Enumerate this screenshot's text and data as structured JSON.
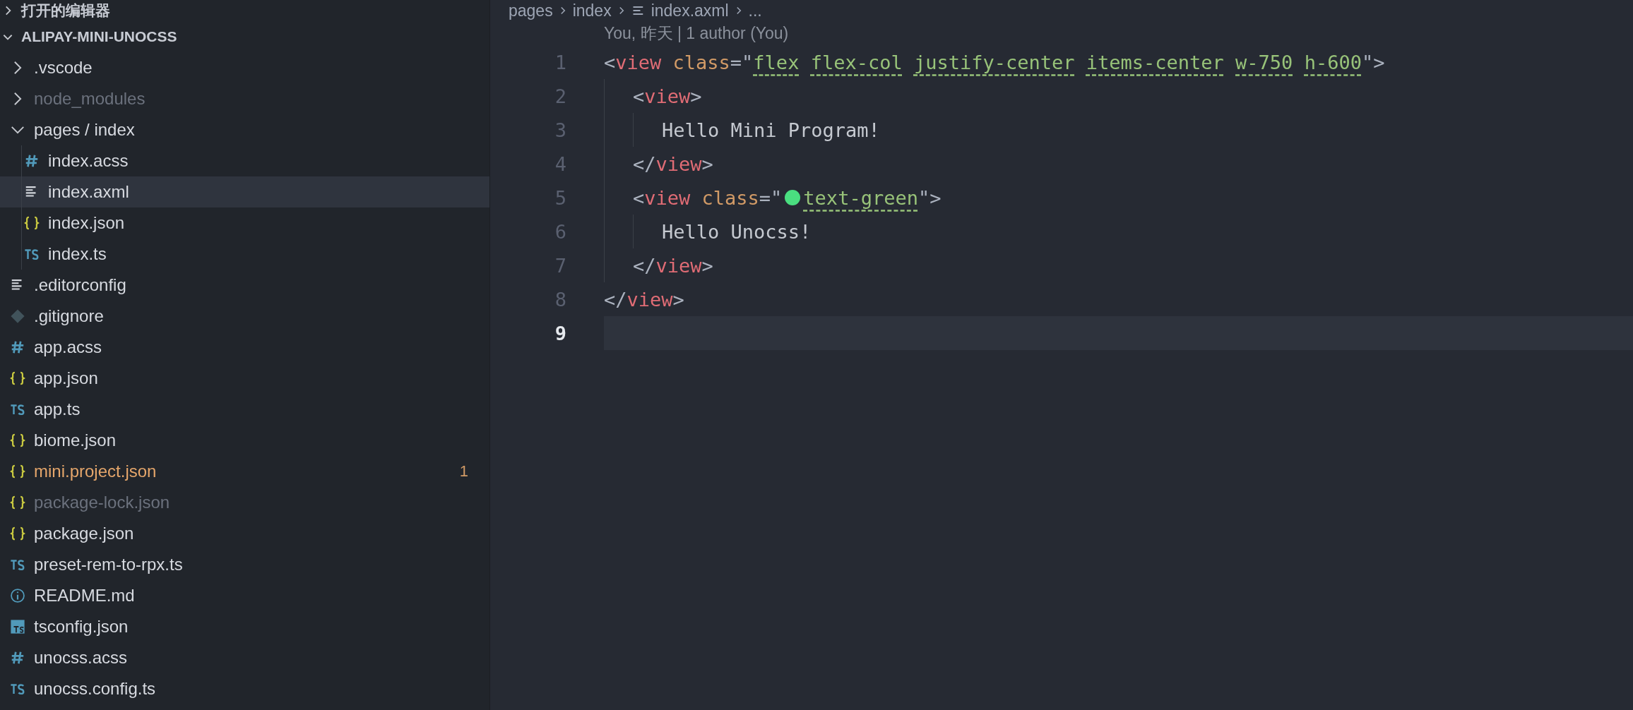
{
  "sidebar": {
    "sections": [
      {
        "label": "打开的编辑器",
        "expanded": false
      },
      {
        "label": "ALIPAY-MINI-UNOCSS",
        "expanded": true
      }
    ],
    "tree": [
      {
        "name": ".vscode",
        "kind": "folder",
        "expanded": false,
        "ignored": false,
        "selected": false
      },
      {
        "name": "node_modules",
        "kind": "folder",
        "expanded": false,
        "ignored": true,
        "selected": false
      },
      {
        "name": "pages / index",
        "kind": "folder",
        "expanded": true,
        "ignored": false,
        "selected": false,
        "children": [
          {
            "name": "index.acss",
            "kind": "css",
            "ignored": false,
            "selected": false
          },
          {
            "name": "index.axml",
            "kind": "lines",
            "ignored": false,
            "selected": true
          },
          {
            "name": "index.json",
            "kind": "json",
            "ignored": false,
            "selected": false
          },
          {
            "name": "index.ts",
            "kind": "ts",
            "ignored": false,
            "selected": false
          }
        ]
      },
      {
        "name": ".editorconfig",
        "kind": "lines",
        "ignored": false,
        "selected": false
      },
      {
        "name": ".gitignore",
        "kind": "git",
        "ignored": false,
        "selected": false
      },
      {
        "name": "app.acss",
        "kind": "css",
        "ignored": false,
        "selected": false
      },
      {
        "name": "app.json",
        "kind": "json",
        "ignored": false,
        "selected": false
      },
      {
        "name": "app.ts",
        "kind": "ts",
        "ignored": false,
        "selected": false
      },
      {
        "name": "biome.json",
        "kind": "json",
        "ignored": false,
        "selected": false
      },
      {
        "name": "mini.project.json",
        "kind": "json",
        "ignored": false,
        "badge": "1",
        "selected": false
      },
      {
        "name": "package-lock.json",
        "kind": "json",
        "ignored": true,
        "selected": false
      },
      {
        "name": "package.json",
        "kind": "json",
        "ignored": false,
        "selected": false
      },
      {
        "name": "preset-rem-to-rpx.ts",
        "kind": "ts",
        "ignored": false,
        "selected": false
      },
      {
        "name": "README.md",
        "kind": "info",
        "ignored": false,
        "selected": false
      },
      {
        "name": "tsconfig.json",
        "kind": "tsconfig",
        "ignored": false,
        "selected": false
      },
      {
        "name": "unocss.acss",
        "kind": "css",
        "ignored": false,
        "selected": false
      },
      {
        "name": "unocss.config.ts",
        "kind": "ts",
        "ignored": false,
        "selected": false
      }
    ]
  },
  "editor": {
    "breadcrumb": [
      "pages",
      "index",
      "index.axml",
      "..."
    ],
    "blame": "You, 昨天 | 1 author (You)",
    "lines": [
      {
        "number": "1",
        "current": false,
        "tokens": [
          {
            "kind": "punct",
            "text": "<"
          },
          {
            "kind": "tag",
            "text": "view"
          },
          {
            "kind": "attr",
            "text": " class"
          },
          {
            "kind": "punct",
            "text": "=\""
          },
          {
            "kind": "class",
            "text": "flex"
          },
          {
            "kind": "class",
            "text": "flex-col"
          },
          {
            "kind": "class",
            "text": "justify-center"
          },
          {
            "kind": "class",
            "text": "items-center"
          },
          {
            "kind": "class",
            "text": "w-750"
          },
          {
            "kind": "class",
            "text": "h-600"
          },
          {
            "kind": "punct",
            "text": "\">"
          }
        ],
        "children": [
          {
            "number": "2",
            "current": false,
            "tokens": [
              {
                "kind": "punct",
                "text": "<"
              },
              {
                "kind": "tag",
                "text": "view"
              },
              {
                "kind": "punct",
                "text": ">"
              }
            ],
            "children": [
              {
                "number": "3",
                "current": false,
                "tokens": [
                  {
                    "kind": "text",
                    "text": "Hello Mini Program!"
                  }
                ]
              }
            ]
          },
          {
            "number": "4",
            "current": false,
            "tokens": [
              {
                "kind": "punct",
                "text": "</"
              },
              {
                "kind": "tag",
                "text": "view"
              },
              {
                "kind": "punct",
                "text": ">"
              }
            ]
          },
          {
            "number": "5",
            "current": false,
            "tokens": [
              {
                "kind": "punct",
                "text": "<"
              },
              {
                "kind": "tag",
                "text": "view"
              },
              {
                "kind": "attr",
                "text": " class"
              },
              {
                "kind": "punct",
                "text": "=\""
              },
              {
                "kind": "swatch",
                "color": "#4ade80"
              },
              {
                "kind": "class",
                "text": "text-green"
              },
              {
                "kind": "punct",
                "text": "\">"
              }
            ],
            "children": [
              {
                "number": "6",
                "current": false,
                "tokens": [
                  {
                    "kind": "text",
                    "text": "Hello Unocss!"
                  }
                ]
              }
            ]
          },
          {
            "number": "7",
            "current": false,
            "tokens": [
              {
                "kind": "punct",
                "text": "</"
              },
              {
                "kind": "tag",
                "text": "view"
              },
              {
                "kind": "punct",
                "text": ">"
              }
            ]
          }
        ]
      },
      {
        "number": "8",
        "current": false,
        "tokens": [
          {
            "kind": "punct",
            "text": "</"
          },
          {
            "kind": "tag",
            "text": "view"
          },
          {
            "kind": "punct",
            "text": ">"
          }
        ]
      },
      {
        "number": "9",
        "current": true
      }
    ]
  }
}
